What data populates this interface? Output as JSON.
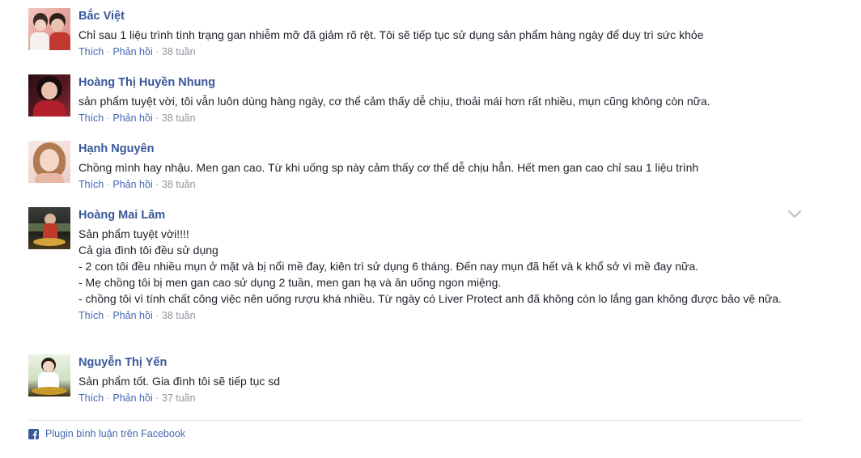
{
  "comments": [
    {
      "name": "Bắc Việt",
      "text": "Chỉ sau 1 liệu trình tình trạng gan nhiễm mỡ đã giảm rõ rệt. Tôi sẽ tiếp tục sử dụng sản phẩm hàng ngày để duy trì sức khỏe",
      "like": "Thích",
      "reply": "Phản hồi",
      "time": "38 tuần"
    },
    {
      "name": "Hoàng Thị Huyền Nhung",
      "text": "sản phẩm tuyệt vời, tôi vẫn luôn dùng hàng ngày, cơ thể cảm thấy dễ chịu, thoải mái hơn rất nhiều, mụn cũng không còn nữa.",
      "like": "Thích",
      "reply": "Phản hồi",
      "time": "38 tuần"
    },
    {
      "name": "Hạnh Nguyên",
      "text": "Chồng mình hay nhậu. Men gan cao. Từ khi uống sp này cảm thấy cơ thể dễ chịu hẳn. Hết men gan cao chỉ sau 1 liệu trình",
      "like": "Thích",
      "reply": "Phản hồi",
      "time": "38 tuần"
    },
    {
      "name": "Hoàng Mai Lâm",
      "text": "Sản phẩm tuyệt vời!!!!\nCả gia đình tôi đều sử dụng\n- 2 con tôi đều nhiều mụn ở mặt và bị nổi mề đay, kiên trì sử dụng 6 tháng. Đến nay mụn đã hết và k khổ sở vì mề đay nữa.\n- Mẹ chồng tôi bị men gan cao sử dụng 2 tuần, men gan hạ và ăn uống ngon miệng.\n- chồng tôi vì tính chất công việc nên uống rượu khá nhiều. Từ ngày có Liver Protect anh đã không còn lo lắng gan không được bảo vệ nữa.",
      "like": "Thích",
      "reply": "Phản hồi",
      "time": "38 tuần"
    },
    {
      "name": "Nguyễn Thị Yến",
      "text": "Sản phẩm tốt. Gia đình tôi sẽ tiếp tục sd",
      "like": "Thích",
      "reply": "Phản hồi",
      "time": "37 tuần"
    }
  ],
  "footer": {
    "label": "Plugin bình luận trên Facebook",
    "icon": "facebook-icon"
  },
  "icons": {
    "options": "chevron-down-icon"
  },
  "colors": {
    "name": "#385898",
    "link": "#4267b2",
    "meta": "#90949c",
    "text": "#1d2129",
    "divider": "#e5e6e9",
    "facebook": "#3b5998"
  }
}
